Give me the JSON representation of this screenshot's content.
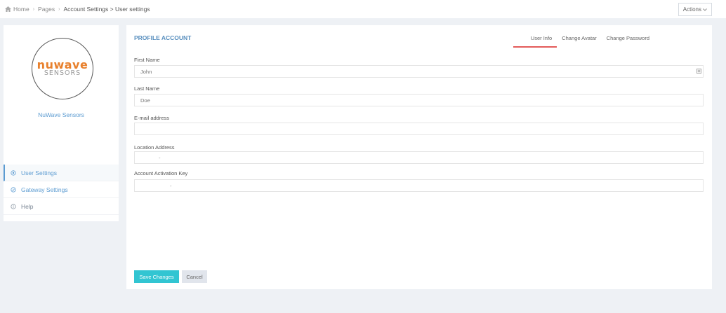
{
  "breadcrumb": {
    "items": [
      "Home",
      "Pages",
      "Account Settings > User settings"
    ]
  },
  "header": {
    "actions_label": "Actions"
  },
  "sidebar": {
    "logo_top": "nuwave",
    "logo_bottom": "SENSORS",
    "profile_name": "NuWave Sensors",
    "items": [
      {
        "label": "User Settings",
        "icon": "user-settings-icon",
        "active": true
      },
      {
        "label": "Gateway Settings",
        "icon": "check-circle-icon",
        "active": false
      },
      {
        "label": "Help",
        "icon": "info-icon",
        "active": false
      }
    ]
  },
  "panel": {
    "title": "PROFILE ACCOUNT",
    "tabs": [
      {
        "label": "User  Info",
        "active": true
      },
      {
        "label": "Change Avatar",
        "active": false
      },
      {
        "label": "Change Password",
        "active": false
      }
    ]
  },
  "form": {
    "first_name": {
      "label": "First Name",
      "placeholder": "John",
      "value": ""
    },
    "last_name": {
      "label": "Last Name",
      "placeholder": "Doe",
      "value": ""
    },
    "email": {
      "label": "E-mail address",
      "placeholder": "",
      "value": ""
    },
    "location": {
      "label": "Location Address",
      "placeholder": "",
      "value": "-"
    },
    "activation_key": {
      "label": "Account Activation Key",
      "placeholder": "",
      "value": "-"
    }
  },
  "buttons": {
    "save": "Save Changes",
    "cancel": "Cancel"
  },
  "colors": {
    "accent": "#5b9bd1",
    "title": "#578ebe",
    "tab_underline": "#e35b5a",
    "save_button": "#32c5d2",
    "cancel_button": "#e1e5ec",
    "logo_orange": "#e8802c"
  }
}
